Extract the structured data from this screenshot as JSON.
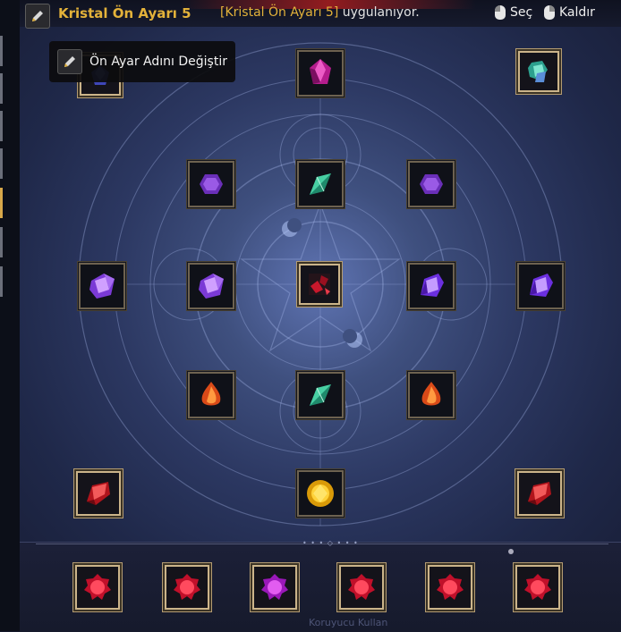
{
  "header": {
    "preset_name": "Kristal Ön Ayarı 5",
    "status_highlight": "[Kristal Ön Ayarı 5]",
    "status_rest": " uygulanıyor.",
    "select_label": "Seç",
    "remove_label": "Kaldır"
  },
  "tooltip": {
    "text": "Ön Ayar Adını Değiştir"
  },
  "footer": {
    "partial_text": "Koruyucu Kullan"
  },
  "colors": {
    "accent_gold": "#e3b23a",
    "background": "#2c3862"
  },
  "slots": [
    {
      "name": "slot-top-left",
      "gem": "blue-gem"
    },
    {
      "name": "slot-top-center",
      "gem": "magenta-crystal"
    },
    {
      "name": "slot-top-right",
      "gem": "teal-cluster"
    },
    {
      "name": "slot-upper-left",
      "gem": "purple-hexagon"
    },
    {
      "name": "slot-upper-center",
      "gem": "teal-marquise"
    },
    {
      "name": "slot-upper-right",
      "gem": "purple-hexagon"
    },
    {
      "name": "slot-mid-far-left",
      "gem": "violet-crystal"
    },
    {
      "name": "slot-mid-left",
      "gem": "violet-crystal"
    },
    {
      "name": "slot-center",
      "gem": "dark-core"
    },
    {
      "name": "slot-mid-right",
      "gem": "violet-crystal"
    },
    {
      "name": "slot-mid-far-right",
      "gem": "violet-crystal"
    },
    {
      "name": "slot-lower-left",
      "gem": "orange-teardrop"
    },
    {
      "name": "slot-lower-center",
      "gem": "teal-marquise"
    },
    {
      "name": "slot-lower-right",
      "gem": "orange-teardrop"
    },
    {
      "name": "slot-bottom-left",
      "gem": "red-crystal"
    },
    {
      "name": "slot-bottom-center",
      "gem": "yellow-round"
    },
    {
      "name": "slot-bottom-right",
      "gem": "red-crystal"
    }
  ],
  "bottom_slots": [
    {
      "name": "bottom-slot-1",
      "gem": "red-round"
    },
    {
      "name": "bottom-slot-2",
      "gem": "red-round"
    },
    {
      "name": "bottom-slot-3",
      "gem": "magenta-round"
    },
    {
      "name": "bottom-slot-4",
      "gem": "red-round"
    },
    {
      "name": "bottom-slot-5",
      "gem": "red-round"
    },
    {
      "name": "bottom-slot-6",
      "gem": "red-round"
    }
  ]
}
